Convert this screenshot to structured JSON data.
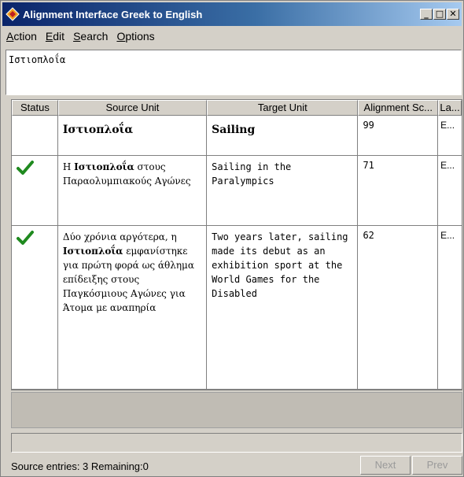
{
  "window": {
    "title": "Alignment Interface Greek to English",
    "controls": {
      "minimize": "_",
      "maximize": "□",
      "close": "✕"
    }
  },
  "menu": [
    {
      "accel": "A",
      "rest": "ction"
    },
    {
      "accel": "E",
      "rest": "dit"
    },
    {
      "accel": "S",
      "rest": "earch"
    },
    {
      "accel": "O",
      "rest": "ptions"
    }
  ],
  "search": {
    "value": "Ιστιοπλοΐα"
  },
  "table": {
    "columns": [
      "Status",
      "Source Unit",
      "Target Unit",
      "Alignment Sc...",
      "La..."
    ],
    "header_row": {
      "source": "Ιστιοπλοΐα",
      "target": "Sailing",
      "score": "99",
      "lang": "E..."
    },
    "rows": [
      {
        "status_icon": "checkmark-icon",
        "source_pre": "Η ",
        "source_term": "Ιστιοπλοΐα",
        "source_post": " στους Παραολυμπιακούς Αγώνες",
        "target": "Sailing in the Paralympics",
        "score": "71",
        "lang": "E..."
      },
      {
        "status_icon": "checkmark-icon",
        "source_pre": "Δύο χρόνια αργότερα, η ",
        "source_term": "Ιστιοπλοΐα",
        "source_post": " εμφανίστηκε για πρώτη φορά ως άθλημα επίδειξης στους Παγκόσμιους Αγώνες για Άτομα με αναπηρία",
        "target": "Two years later, sailing made its debut as an exhibition sport at the World Games for the Disabled",
        "score": "62",
        "lang": "E..."
      }
    ]
  },
  "status_text": "Source entries: 3 Remaining:0",
  "buttons": {
    "next": "Next",
    "prev": "Prev"
  },
  "colors": {
    "title_start": "#0a246a",
    "title_end": "#a6caf0",
    "check": "#1f8a1f",
    "disabled_text": "#9a9a9a"
  }
}
